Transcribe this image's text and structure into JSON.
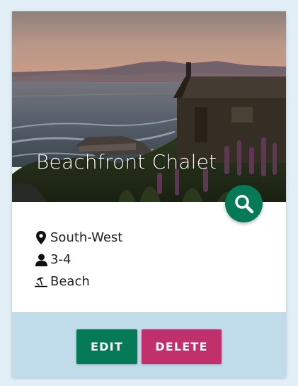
{
  "card": {
    "title": "Beachfront Chalet",
    "details": [
      {
        "icon": "map-marker-icon",
        "text": "South-West"
      },
      {
        "icon": "user-icon",
        "text": "3-4"
      },
      {
        "icon": "beach-umbrella-icon",
        "text": "Beach"
      }
    ],
    "actions": {
      "edit_label": "EDIT",
      "delete_label": "DELETE"
    }
  },
  "colors": {
    "page_background": "#e3eff7",
    "footer_background": "#c0dceb",
    "primary": "#067a56",
    "danger": "#c0306a"
  },
  "icons": {
    "fab": "search-icon"
  }
}
